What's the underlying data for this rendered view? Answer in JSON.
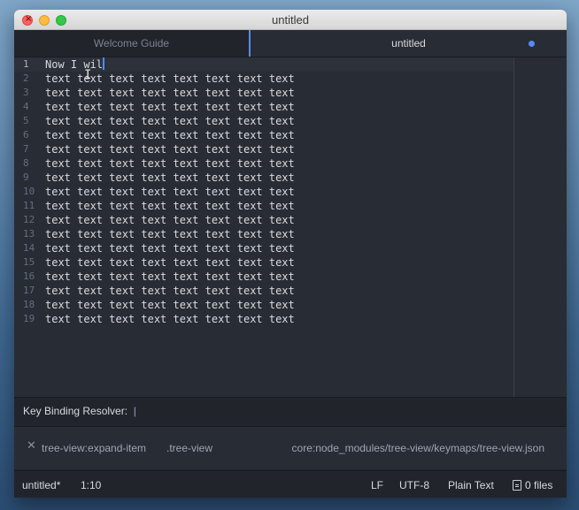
{
  "window": {
    "title": "untitled"
  },
  "tabs": [
    {
      "label": "Welcome Guide",
      "active": false
    },
    {
      "label": "untitled",
      "active": true,
      "modified": true
    }
  ],
  "editor": {
    "lines": [
      "Now I wil",
      "text text text text text text text text",
      "text text text text text text text text",
      "text text text text text text text text",
      "text text text text text text text text",
      "text text text text text text text text",
      "text text text text text text text text",
      "text text text text text text text text",
      "text text text text text text text text",
      "text text text text text text text text",
      "text text text text text text text text",
      "text text text text text text text text",
      "text text text text text text text text",
      "text text text text text text text text",
      "text text text text text text text text",
      "text text text text text text text text",
      "text text text text text text text text",
      "text text text text text text text text",
      "text text text text text text text text"
    ],
    "cursor_line": 1
  },
  "key_binding_resolver": {
    "header": "Key Binding Resolver:",
    "binding": {
      "command": "tree-view:expand-item",
      "selector": ".tree-view",
      "source": "core:node_modules/tree-view/keymaps/tree-view.json"
    }
  },
  "status_bar": {
    "file": "untitled*",
    "position": "1:10",
    "line_ending": "LF",
    "encoding": "UTF-8",
    "grammar": "Plain Text",
    "files": "0 files"
  },
  "colors": {
    "accent": "#568af2",
    "editor_bg": "#282c34",
    "panel_bg": "#21252b"
  },
  "icons": {
    "close": "close-icon",
    "remove_binding": "x-icon",
    "files": "file-icon"
  }
}
